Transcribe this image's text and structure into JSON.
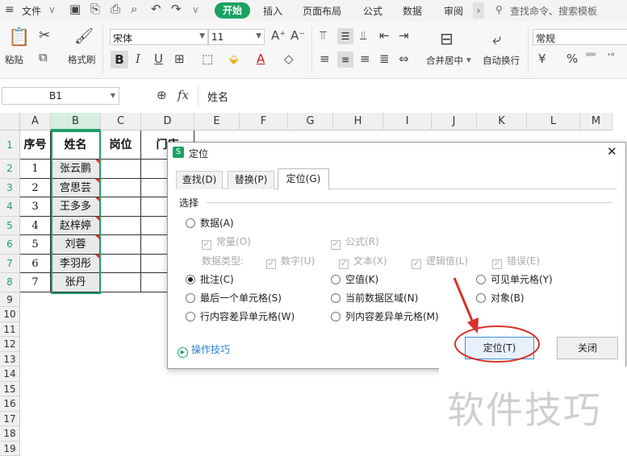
{
  "menubar": {
    "file": "文件",
    "tabs": [
      "开始",
      "插入",
      "页面布局",
      "公式",
      "数据",
      "审阅"
    ],
    "active_tab": "开始",
    "search": "查找命令、搜索模板"
  },
  "ribbon": {
    "paste": "粘贴",
    "format_painter": "格式刷",
    "font_name": "宋体",
    "font_size": "11",
    "bold": "B",
    "italic": "I",
    "underline": "U",
    "merge": "合并居中",
    "wrap": "自动换行",
    "number_format": "常规",
    "currency": "¥",
    "percent": "%"
  },
  "formula_bar": {
    "cell_ref": "B1",
    "fx": "fx",
    "value": "姓名"
  },
  "columns": [
    "A",
    "B",
    "C",
    "D",
    "E",
    "F",
    "G",
    "H",
    "I",
    "J",
    "K",
    "L",
    "M"
  ],
  "rows": [
    "1",
    "2",
    "3",
    "4",
    "5",
    "6",
    "7",
    "8",
    "9",
    "10",
    "11",
    "12",
    "13",
    "14",
    "15",
    "16",
    "17",
    "18",
    "19"
  ],
  "table": {
    "headers": [
      "序号",
      "姓名",
      "岗位",
      "门店"
    ],
    "rows": [
      [
        "1",
        "张云鹏"
      ],
      [
        "2",
        "宫思芸"
      ],
      [
        "3",
        "王多多"
      ],
      [
        "4",
        "赵梓婷"
      ],
      [
        "5",
        "刘蓉"
      ],
      [
        "6",
        "李羽彤"
      ],
      [
        "7",
        "张丹"
      ]
    ]
  },
  "dialog": {
    "title": "定位",
    "tabs": [
      "查找(D)",
      "替换(P)",
      "定位(G)"
    ],
    "active_tab": "定位(G)",
    "section": "选择",
    "data_option": "数据(A)",
    "constants": "常量(O)",
    "formulas": "公式(R)",
    "data_type_label": "数据类型:",
    "types": [
      "数字(U)",
      "文本(X)",
      "逻辑值(L)",
      "错误(E)"
    ],
    "col1": [
      "批注(C)",
      "最后一个单元格(S)",
      "行内容差异单元格(W)"
    ],
    "col2": [
      "空值(K)",
      "当前数据区域(N)",
      "列内容差异单元格(M)"
    ],
    "col3": [
      "可见单元格(Y)",
      "对象(B)"
    ],
    "selected": "批注(C)",
    "tips": "操作技巧",
    "ok": "定位(T)",
    "close": "关闭"
  },
  "watermark": "软件技巧",
  "colors": {
    "accent": "#1aa260",
    "selection": "#1e9e6a",
    "annotation": "#d9322b"
  }
}
